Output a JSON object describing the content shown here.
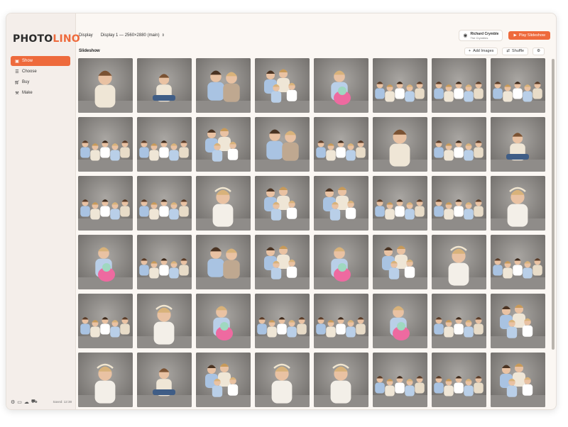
{
  "window": {
    "traffic_colors": [
      "#f05a50",
      "#f6be3a",
      "#3cc84a"
    ]
  },
  "sidebar": {
    "logo_main": "PHOTO",
    "logo_accent": "LINO",
    "accent_color": "#ee6a3c",
    "items": [
      {
        "label": "Show",
        "icon": "slideshow-icon",
        "active": true
      },
      {
        "label": "Choose",
        "icon": "checklist-icon",
        "active": false
      },
      {
        "label": "Buy",
        "icon": "cart-icon",
        "active": false
      },
      {
        "label": "Make",
        "icon": "wrench-icon",
        "active": false
      }
    ],
    "footer": {
      "icons": [
        "gear-icon",
        "chat-icon",
        "cloud-icon",
        "truck-icon"
      ],
      "saved": "Saved: 12:38"
    }
  },
  "header": {
    "display_label": "Display",
    "display_value": "Display 1 — 2560×2880 (main)",
    "user_name": "Richard Crymble",
    "user_team": "The Crymbles",
    "play_label": "Play Slideshow"
  },
  "section": {
    "title": "Slideshow",
    "add_images": "Add Images",
    "shuffle": "Shuffle"
  },
  "photos": [
    "boy",
    "boy-sit",
    "couple",
    "family4",
    "girl-toy",
    "family-sit",
    "family-sit",
    "family-sit",
    "family-sit",
    "family-sit",
    "family4",
    "couple",
    "family-sit",
    "boy",
    "family-sit",
    "boy-sit",
    "family-sit",
    "family-sit",
    "girl",
    "family4",
    "family4",
    "family-sit",
    "family-sit",
    "girl",
    "girl-toy",
    "family-sit",
    "couple",
    "family4",
    "girl-toy",
    "family4",
    "girl",
    "family-sit",
    "family-sit",
    "girl",
    "girl-toy",
    "family-sit",
    "family-sit",
    "girl-toy",
    "family-sit",
    "family4",
    "girl",
    "boy-sit",
    "family4",
    "girl",
    "girl",
    "family-sit",
    "family-sit",
    "family4"
  ]
}
